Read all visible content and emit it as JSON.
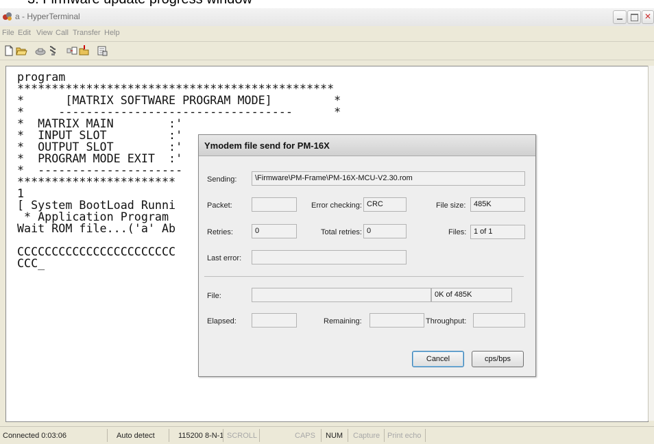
{
  "caption": "3. Firmware update progress window",
  "window": {
    "title": "a - HyperTerminal"
  },
  "menu": [
    "File",
    "Edit",
    "View",
    "Call",
    "Transfer",
    "Help"
  ],
  "toolbar": [
    "new-document-icon",
    "open-folder-icon",
    "phone-icon",
    "disconnect-icon",
    "send-icon",
    "receive-icon",
    "properties-icon"
  ],
  "terminal": {
    "text": "program\n**********************************************\n*      [MATRIX SOFTWARE PROGRAM MODE]         *\n*     ----------------------------------      *\n*  MATRIX MAIN        :'\n*  INPUT SLOT         :'\n*  OUTPUT SLOT        :'\n*  PROGRAM MODE EXIT  :'\n*  ---------------------\n***********************\n1\n[ System BootLoad Runni\n * Application Program\nWait ROM file...('a' Ab\n\nCCCCCCCCCCCCCCCCCCCCCCC                             CCCCCCCCCCCCC\nCCC_"
  },
  "dialog": {
    "title": "Ymodem file send for PM-16X",
    "sending_label": "Sending:",
    "sending_value": "\\Firmware\\PM-Frame\\PM-16X-MCU-V2.30.rom",
    "packet_label": "Packet:",
    "packet_value": "",
    "error_checking_label": "Error checking:",
    "error_checking_value": "CRC",
    "file_size_label": "File size:",
    "file_size_value": "485K",
    "retries_label": "Retries:",
    "retries_value": "0",
    "total_retries_label": "Total retries:",
    "total_retries_value": "0",
    "files_label": "Files:",
    "files_value": "1 of 1",
    "last_error_label": "Last error:",
    "last_error_value": "",
    "file_label": "File:",
    "file_progress_value": "",
    "file_progress_text": "0K of 485K",
    "elapsed_label": "Elapsed:",
    "elapsed_value": "",
    "remaining_label": "Remaining:",
    "remaining_value": "",
    "throughput_label": "Throughput:",
    "throughput_value": "",
    "cancel_label": "Cancel",
    "cps_label": "cps/bps"
  },
  "status": {
    "connected": "Connected 0:03:06",
    "detect": "Auto detect",
    "settings": "115200 8-N-1",
    "scroll": "SCROLL",
    "caps": "CAPS",
    "num": "NUM",
    "capture": "Capture",
    "print_echo": "Print echo"
  }
}
